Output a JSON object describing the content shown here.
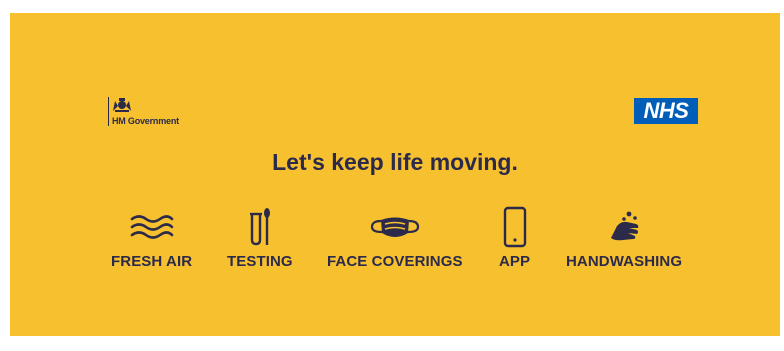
{
  "logos": {
    "government": "HM Government",
    "nhs": "NHS"
  },
  "headline": "Let's keep life moving.",
  "items": [
    {
      "label": "FRESH AIR",
      "icon": "fresh-air-icon"
    },
    {
      "label": "TESTING",
      "icon": "test-tube-icon"
    },
    {
      "label": "FACE COVERINGS",
      "icon": "face-mask-icon"
    },
    {
      "label": "APP",
      "icon": "phone-icon"
    },
    {
      "label": "HANDWASHING",
      "icon": "handwashing-icon"
    }
  ],
  "colors": {
    "background": "#f6c02e",
    "text": "#2c2a4a",
    "nhs_blue": "#005eb8"
  }
}
